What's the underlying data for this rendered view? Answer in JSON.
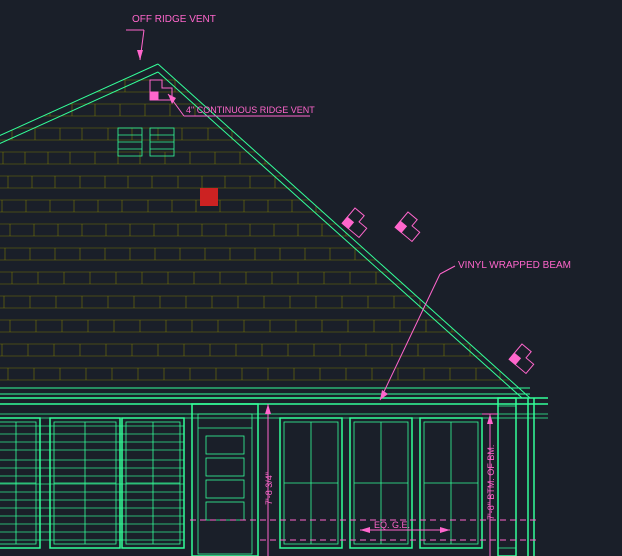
{
  "annotations": {
    "off_ridge_vent": "OFF RIDGE VENT",
    "cont_ridge_vent": "4\" CONTINUOUS RIDGE VENT",
    "vinyl_beam": "VINYL WRAPPED BEAM",
    "door_height": "7'-8 3/4\"",
    "beam_height": "7'-8\" BTM. OF BM.",
    "eq_note": "EQ. G.E."
  },
  "colors": {
    "bg": "#1a1f29",
    "green": "#33ff99",
    "pink": "#ff66cc",
    "olive": "#808000",
    "red": "#cc2222"
  }
}
